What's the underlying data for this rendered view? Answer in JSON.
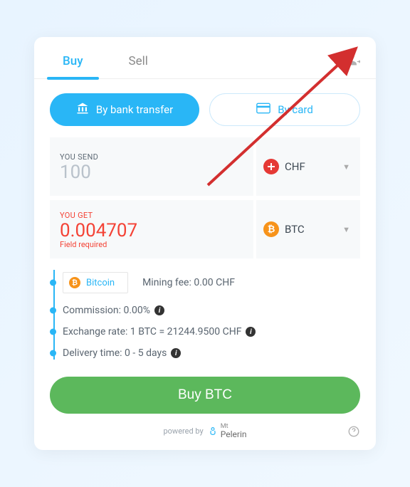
{
  "tabs": {
    "buy": "Buy",
    "sell": "Sell"
  },
  "methods": {
    "bank": "By bank transfer",
    "card": "By card"
  },
  "send": {
    "label": "YOU SEND",
    "value": "100",
    "currency": "CHF"
  },
  "get": {
    "label": "YOU GET",
    "value": "0.004707",
    "currency": "BTC",
    "error": "Field required"
  },
  "network": {
    "label": "Bitcoin"
  },
  "details": {
    "mining_fee": "Mining fee: 0.00 CHF",
    "commission": "Commission: 0.00%",
    "rate": "Exchange rate: 1 BTC = 21244.9500 CHF",
    "delivery": "Delivery time: 0 - 5 days"
  },
  "buy_button": "Buy BTC",
  "footer": {
    "powered_by": "powered by",
    "brand_top": "Mt",
    "brand_bottom": "Pelerin"
  }
}
